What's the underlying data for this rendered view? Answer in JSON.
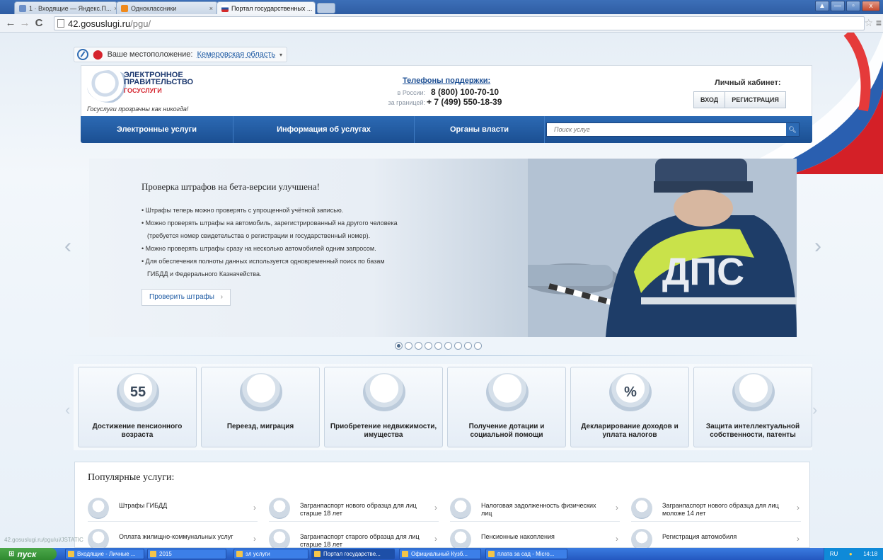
{
  "browser": {
    "tabs": [
      {
        "label": "1 · Входящие — Яндекс.П...",
        "close": "×"
      },
      {
        "label": "Одноклассники",
        "close": "×"
      },
      {
        "label": "Портал государственных ...",
        "close": "×"
      }
    ],
    "url_host": "42.gosuslugi.ru",
    "url_path": "/pgu/",
    "window_buttons": [
      "▲",
      "—",
      "▫",
      "x"
    ]
  },
  "location": {
    "label": "Ваше местоположение:",
    "value": "Кемеровская область"
  },
  "logo": {
    "line1": "ЭЛЕКТРОННОЕ",
    "line2": "ПРАВИТЕЛЬСТВО",
    "line3": "ГОСУСЛУГИ",
    "tagline": "Госуслуги прозрачны как никогда!"
  },
  "support": {
    "title": "Телефоны поддержки:",
    "russia_label": "в России:",
    "russia_phone": "8 (800) 100-70-10",
    "abroad_label": "за границей:",
    "abroad_phone": "+ 7 (499) 550-18-39"
  },
  "cabinet": {
    "title": "Личный кабинет:",
    "login": "ВХОД",
    "register": "РЕГИСТРАЦИЯ"
  },
  "menu": {
    "items": [
      "Электронные услуги",
      "Информация об услугах",
      "Органы власти"
    ],
    "search_placeholder": "Поиск услуг"
  },
  "slide": {
    "title": "Проверка штрафов на бета-версии улучшена!",
    "bullets": [
      "Штрафы теперь можно проверять с упрощенной учётной записью.",
      "Можно проверять штрафы на автомобиль, зарегистрированный на другого человека",
      "(требуется номер свидетельства о регистрации и государственный номер).",
      "Можно проверять штрафы сразу на несколько автомобилей одним запросом.",
      "Для обеспечения полноты данных используется одновременный поиск по базам",
      "ГИБДД и Федерального Казначейства."
    ],
    "button": "Проверить штрафы",
    "badge_text": "ДПС",
    "dots_total": 9,
    "dots_active_index": 0
  },
  "categories": [
    {
      "label": "Достижение пенсионного возраста",
      "icon": "calendar-55-icon",
      "icon_text": "55"
    },
    {
      "label": "Переезд, миграция",
      "icon": "passport-icon",
      "icon_text": ""
    },
    {
      "label": "Приобретение недвижимости, имущества",
      "icon": "keys-icon",
      "icon_text": ""
    },
    {
      "label": "Получение дотации и социальной помощи",
      "icon": "lifebuoy-icon",
      "icon_text": ""
    },
    {
      "label": "Декларирование доходов и уплата налогов",
      "icon": "percent-icon",
      "icon_text": "%"
    },
    {
      "label": "Защита интеллектуальной собственности, патенты",
      "icon": "certificate-icon",
      "icon_text": ""
    }
  ],
  "popular": {
    "title": "Популярные услуги:",
    "items": [
      {
        "label": "Штрафы ГИБДД",
        "icon": "traffic-light-icon"
      },
      {
        "label": "Загранпаспорт нового образца для лиц старше 18 лет",
        "icon": "passport-icon"
      },
      {
        "label": "Налоговая задолженность физических лиц",
        "icon": "tax-icon"
      },
      {
        "label": "Загранпаспорт нового образца для лиц моложе 14 лет",
        "icon": "passport-child-icon"
      },
      {
        "label": "Оплата жилищно-коммунальных услуг",
        "icon": "housing-icon"
      },
      {
        "label": "Загранпаспорт старого образца для лиц старше 18 лет",
        "icon": "passport-old-icon"
      },
      {
        "label": "Пенсионные накопления",
        "icon": "piggy-bank-icon"
      },
      {
        "label": "Регистрация автомобиля",
        "icon": "car-registration-icon"
      }
    ]
  },
  "status_url": "42.gosuslugi.ru/pgu/ui/JSTATIC",
  "taskbar": {
    "start": "пуск",
    "tasks": [
      "Входящие - Личные ...",
      "2015",
      "эл услуги",
      "Портал государстве...",
      "Официальный Кузб...",
      "плата за сад - Micro..."
    ],
    "lang": "RU",
    "time": "14:18"
  }
}
